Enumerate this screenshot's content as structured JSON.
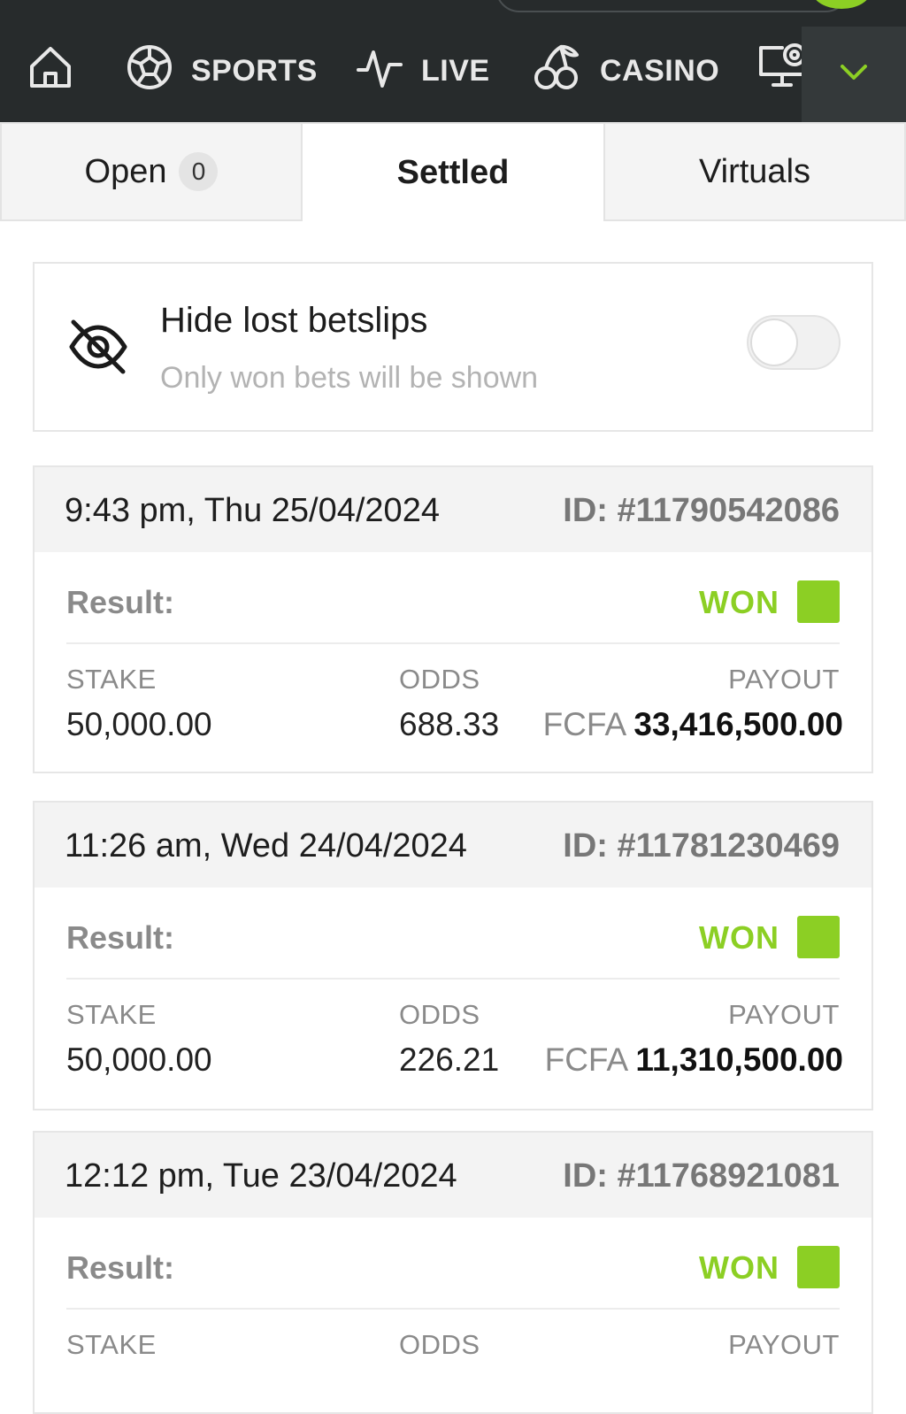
{
  "nav": {
    "items": [
      {
        "label": "",
        "icon": "home-icon"
      },
      {
        "label": "SPORTS",
        "icon": "soccer-ball-icon"
      },
      {
        "label": "LIVE",
        "icon": "pulse-icon"
      },
      {
        "label": "CASINO",
        "icon": "cherries-icon"
      },
      {
        "label": "",
        "icon": "virtual-monitor-icon"
      }
    ],
    "more_icon": "chevron-down-icon"
  },
  "tabs": [
    {
      "label": "Open",
      "badge": "0"
    },
    {
      "label": "Settled"
    },
    {
      "label": "Virtuals"
    }
  ],
  "hide_lost": {
    "title": "Hide lost betslips",
    "subtitle": "Only won bets will be shown",
    "icon": "eye-off-icon",
    "enabled": false
  },
  "bets": [
    {
      "date": "9:43 pm, Thu 25/04/2024",
      "id": "ID: #11790542086",
      "result_label": "Result:",
      "result": "WON",
      "stake_label": "STAKE",
      "stake": "50,000.00",
      "odds_label": "ODDS",
      "odds": "688.33",
      "payout_label": "PAYOUT",
      "currency": "FCFA",
      "payout": "33,416,500.00"
    },
    {
      "date": "11:26 am, Wed 24/04/2024",
      "id": "ID: #11781230469",
      "result_label": "Result:",
      "result": "WON",
      "stake_label": "STAKE",
      "stake": "50,000.00",
      "odds_label": "ODDS",
      "odds": "226.21",
      "payout_label": "PAYOUT",
      "currency": "FCFA",
      "payout": "11,310,500.00"
    },
    {
      "date": "12:12 pm, Tue 23/04/2024",
      "id": "ID: #11768921081",
      "result_label": "Result:",
      "result": "WON",
      "stake_label": "STAKE",
      "odds_label": "ODDS",
      "payout_label": "PAYOUT"
    }
  ],
  "colors": {
    "topbar": "#272b2c",
    "accent_green": "#8ccf24",
    "muted_text": "#8a8a8a"
  }
}
